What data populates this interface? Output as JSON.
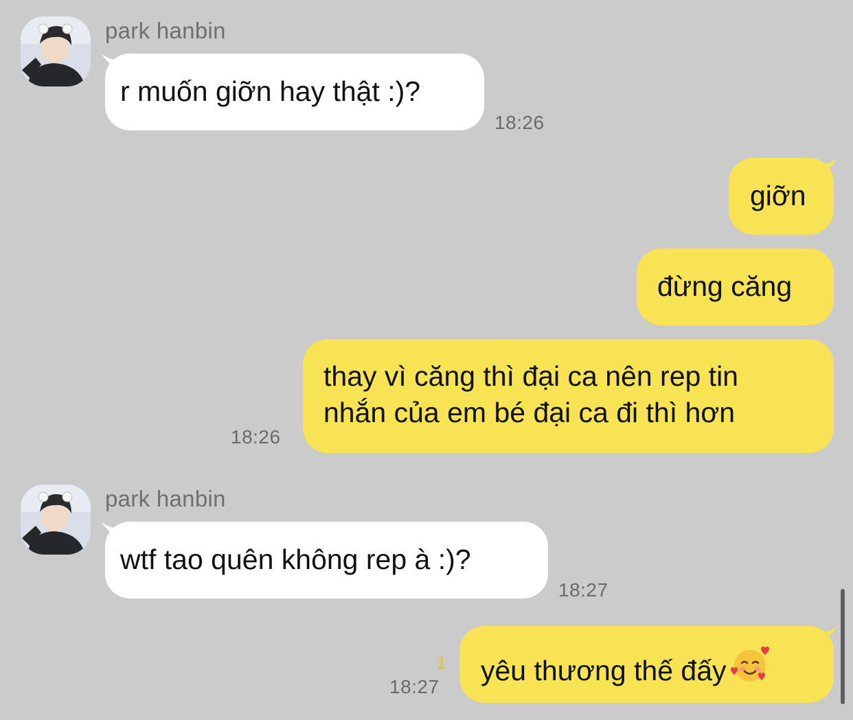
{
  "colors": {
    "background": "#cbcbcb",
    "incoming_bubble": "#ffffff",
    "outgoing_bubble": "#f7e353",
    "unread": "#e6c400"
  },
  "messages": [
    {
      "sender": "park hanbin",
      "text": "r muốn giỡn hay thật :)?",
      "time": "18:26"
    },
    {
      "text": "giỡn"
    },
    {
      "text": "đừng căng"
    },
    {
      "text_line1": "thay vì căng thì đại ca nên rep tin",
      "text_line2": "nhắn của em bé đại ca đi thì hơn",
      "time": "18:26"
    },
    {
      "sender": "park hanbin",
      "text": "wtf tao quên không rep à :)?",
      "time": "18:27"
    },
    {
      "text": "yêu thương thế đấy",
      "emoji_icon": "smiling-face-with-hearts-icon",
      "unread_count": "1",
      "time": "18:27"
    }
  ]
}
